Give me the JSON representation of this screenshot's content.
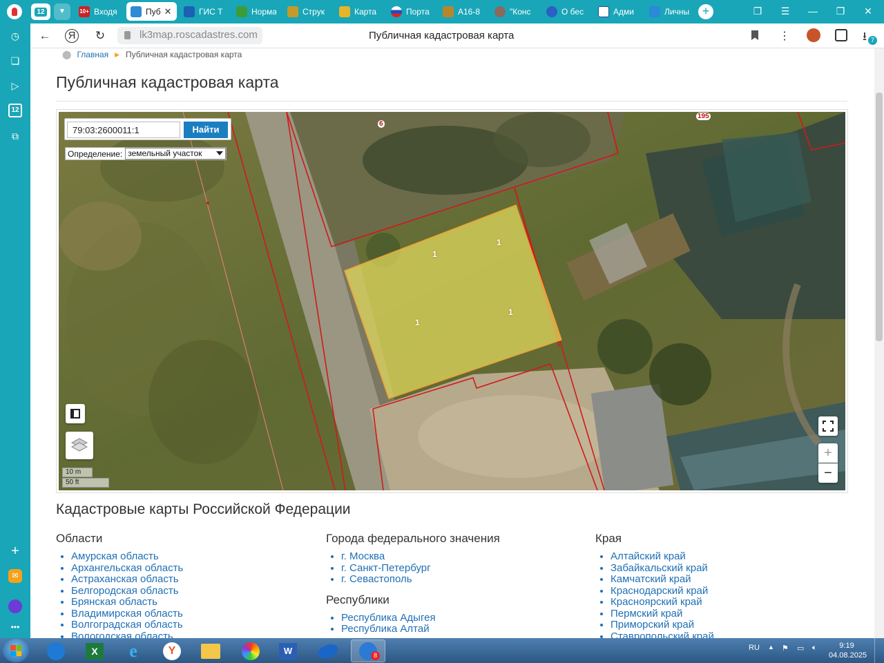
{
  "browser": {
    "profile_badge": "12",
    "tabs": [
      {
        "label": "Входя",
        "icon": "mail-badge-icon"
      },
      {
        "label": "Пуб",
        "icon": "cadastre-icon",
        "active": true
      },
      {
        "label": "ГИС Т",
        "icon": "gis-icon"
      },
      {
        "label": "Норма",
        "icon": "law-icon"
      },
      {
        "label": "Струк",
        "icon": "emblem-icon"
      },
      {
        "label": "Карта",
        "icon": "map-icon"
      },
      {
        "label": "Порта",
        "icon": "flag-icon"
      },
      {
        "label": "А16-8",
        "icon": "emblem-icon"
      },
      {
        "label": "\"Конс",
        "icon": "user-icon"
      },
      {
        "label": "О бес",
        "icon": "link-icon"
      },
      {
        "label": "Адми",
        "icon": "chart-icon"
      },
      {
        "label": "Личны",
        "icon": "shield-icon"
      }
    ],
    "url": "lk3map.roscadastres.com",
    "page_title": "Публичная кадастровая карта",
    "downloads_badge": "7",
    "sidebar_badge": "12"
  },
  "page": {
    "breadcrumb": {
      "home": "Главная",
      "current": "Публичная кадастровая карта"
    },
    "heading": "Публичная кадастровая карта",
    "map": {
      "search_value": "79:03:2600011:1",
      "search_button": "Найти",
      "definition_label": "Определение:",
      "definition_value": "земельный участок",
      "scale_metric": "10 m",
      "scale_imperial": "50 ft",
      "zoom_in": "+",
      "zoom_out": "−",
      "parcel_labels": [
        "1",
        "1",
        "1",
        "1"
      ],
      "top_labels": [
        "6",
        "195"
      ]
    },
    "section_title": "Кадастровые карты Российской Федерации",
    "oblasti": {
      "title": "Области",
      "items": [
        "Амурская область",
        "Архангельская область",
        "Астраханская область",
        "Белгородская область",
        "Брянская область",
        "Владимирская область",
        "Волгоградская область",
        "Вологодская область"
      ]
    },
    "cities": {
      "title": "Города федерального значения",
      "items": [
        "г. Москва",
        "г. Санкт-Петербург",
        "г. Севастополь"
      ]
    },
    "republics": {
      "title": "Республики",
      "items": [
        "Республика Адыгея",
        "Республика Алтай"
      ]
    },
    "krai": {
      "title": "Края",
      "items": [
        "Алтайский край",
        "Забайкальский край",
        "Камчатский край",
        "Краснодарский край",
        "Красноярский край",
        "Пермский край",
        "Приморский край",
        "Ставропольский край"
      ]
    }
  },
  "taskbar": {
    "lang": "RU",
    "time": "9:19",
    "date": "04.08.2025",
    "badge": "8"
  }
}
